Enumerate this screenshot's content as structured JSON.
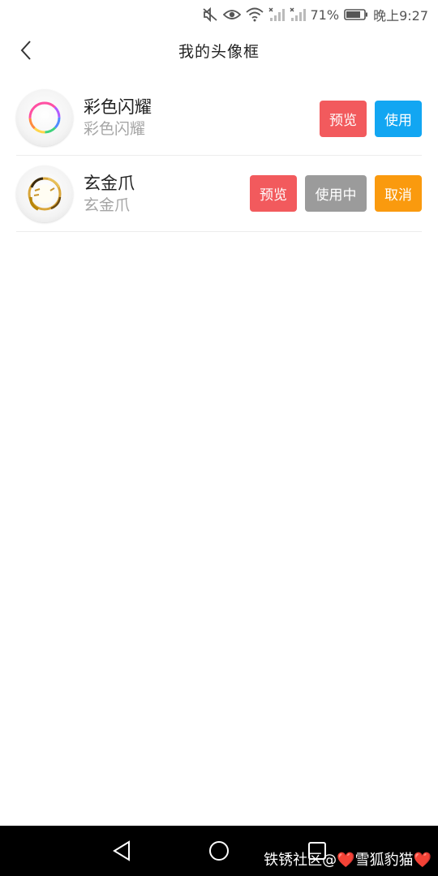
{
  "status_bar": {
    "battery": "71%",
    "time": "晚上9:27",
    "icons": [
      "mute-icon",
      "eye-icon",
      "wifi-icon",
      "signal-icon",
      "signal-icon",
      "battery-icon"
    ]
  },
  "header": {
    "title": "我的头像框",
    "back_icon": "chevron-left-icon"
  },
  "frames": [
    {
      "name": "彩色闪耀",
      "subtitle": "彩色闪耀",
      "buttons": {
        "preview": "预览",
        "use": "使用"
      }
    },
    {
      "name": "玄金爪",
      "subtitle": "玄金爪",
      "buttons": {
        "preview": "预览",
        "in_use": "使用中",
        "cancel": "取消"
      }
    }
  ],
  "colors": {
    "preview": "#f25a5d",
    "use": "#12a6f2",
    "in_use": "#9b9b9b",
    "cancel": "#fa9a0e"
  },
  "nav_bar": {
    "icons": [
      "back-triangle-icon",
      "home-circle-icon",
      "recents-square-icon"
    ],
    "watermark": "铁锈社区@❤️雪狐豹猫❤️"
  }
}
